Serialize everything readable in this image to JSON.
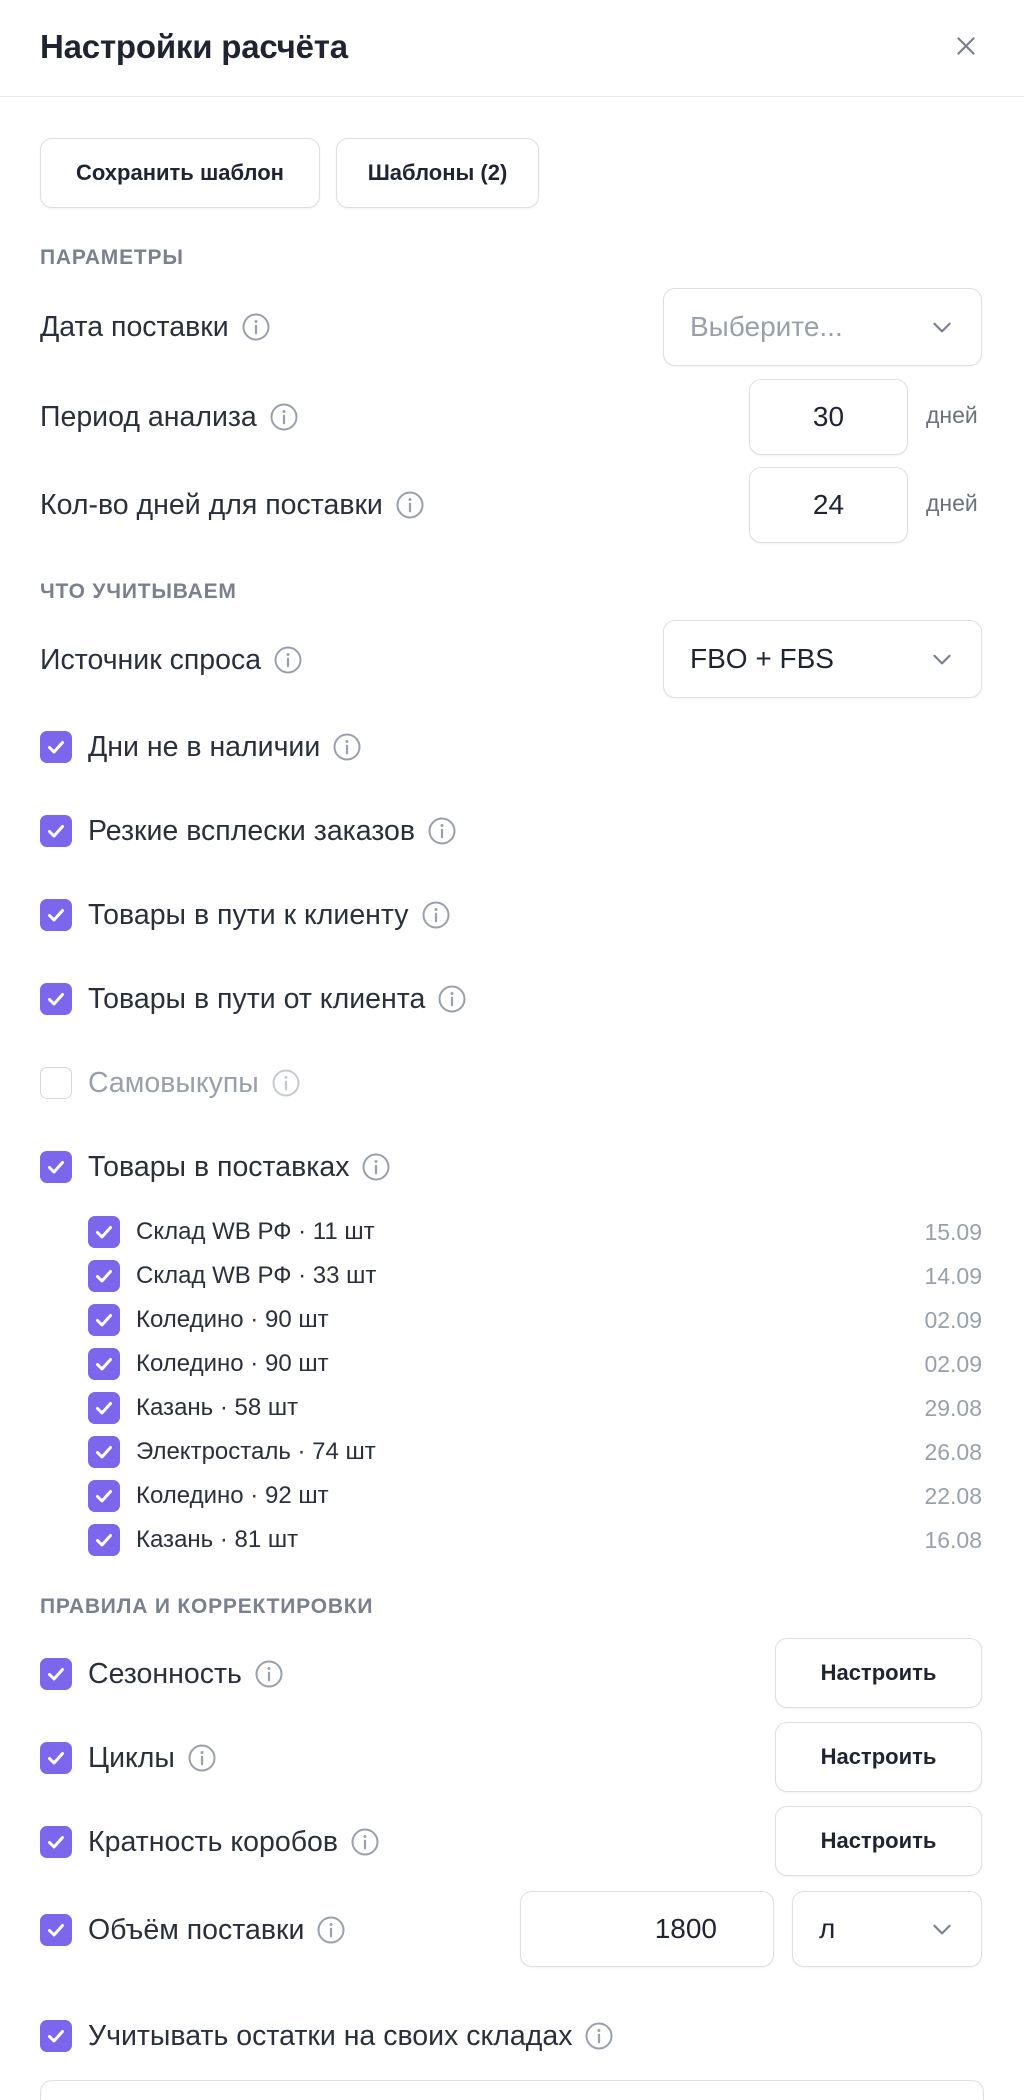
{
  "title": "Настройки расчёта",
  "toolbar": {
    "save_template": "Сохранить шаблон",
    "templates": "Шаблоны (2)"
  },
  "sections": {
    "params": "ПАРАМЕТРЫ",
    "considered": "ЧТО УЧИТЫВАЕМ",
    "rules": "ПРАВИЛА И КОРРЕКТИРОВКИ"
  },
  "params": {
    "delivery_date": {
      "label": "Дата поставки",
      "placeholder": "Выберите..."
    },
    "analysis_period": {
      "label": "Период анализа",
      "value": "30",
      "unit": "дней"
    },
    "delivery_days": {
      "label": "Кол-во дней для поставки",
      "value": "24",
      "unit": "дней"
    }
  },
  "demand_source": {
    "label": "Источник спроса",
    "value": "FBO + FBS"
  },
  "options": [
    {
      "label": "Дни не в наличии",
      "checked": true
    },
    {
      "label": "Резкие всплески заказов",
      "checked": true
    },
    {
      "label": "Товары в пути к клиенту",
      "checked": true
    },
    {
      "label": "Товары в пути от клиента",
      "checked": true
    },
    {
      "label": "Самовыкупы",
      "checked": false
    },
    {
      "label": "Товары в поставках",
      "checked": true
    }
  ],
  "supplies": [
    {
      "label": "Склад WB РФ · 11 шт",
      "date": "15.09",
      "checked": true
    },
    {
      "label": "Склад WB РФ · 33 шт",
      "date": "14.09",
      "checked": true
    },
    {
      "label": "Коледино · 90 шт",
      "date": "02.09",
      "checked": true
    },
    {
      "label": "Коледино · 90 шт",
      "date": "02.09",
      "checked": true
    },
    {
      "label": "Казань · 58 шт",
      "date": "29.08",
      "checked": true
    },
    {
      "label": "Электросталь · 74 шт",
      "date": "26.08",
      "checked": true
    },
    {
      "label": "Коледино · 92 шт",
      "date": "22.08",
      "checked": true
    },
    {
      "label": "Казань · 81 шт",
      "date": "16.08",
      "checked": true
    }
  ],
  "rules": {
    "seasonality": {
      "label": "Сезонность",
      "button": "Настроить",
      "checked": true
    },
    "cycles": {
      "label": "Циклы",
      "button": "Настроить",
      "checked": true
    },
    "box_multiple": {
      "label": "Кратность коробов",
      "button": "Настроить",
      "checked": true
    },
    "volume": {
      "label": "Объём поставки",
      "value": "1800",
      "unit": "л",
      "checked": true
    },
    "own_stock": {
      "label": "Учитывать остатки на своих складах",
      "checked": true
    }
  },
  "colors": {
    "accent": "#7c66ec",
    "border": "#dcdfe4",
    "muted": "#9aa0aa"
  }
}
